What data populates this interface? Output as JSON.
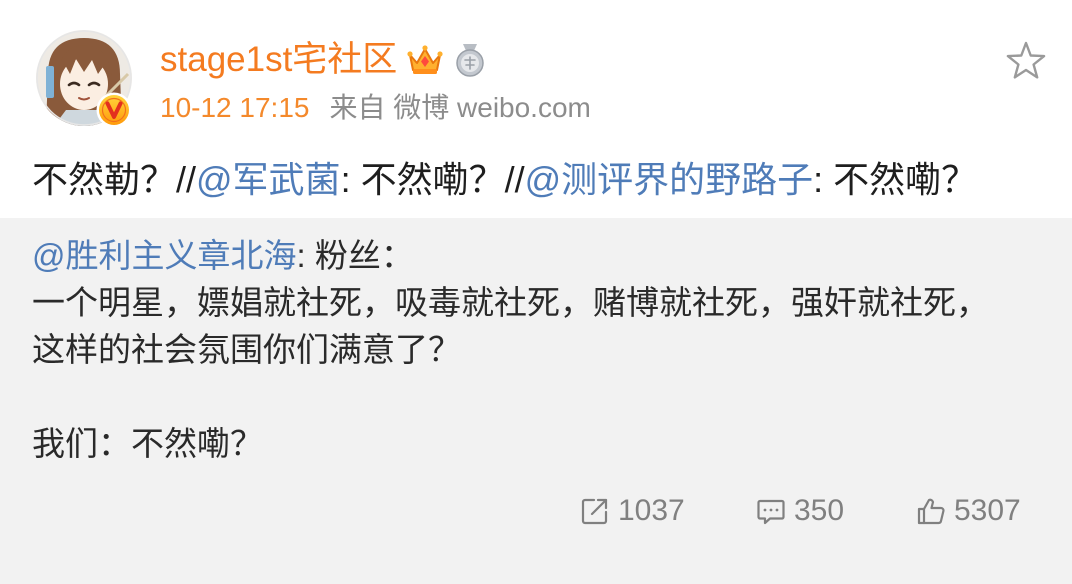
{
  "colors": {
    "name": "#f47b20",
    "time": "#f4892b",
    "muted": "#8c8c8c",
    "link": "#4f7cb8",
    "retweet_bg": "#f2f2f2",
    "action": "#808080"
  },
  "post": {
    "author": {
      "name": "stage1st宅社区",
      "avatar_icon": "avatar-anime-girl",
      "verified_icon": "verified-v-icon",
      "badges": [
        {
          "icon": "crown-icon"
        },
        {
          "icon": "medal-icon"
        }
      ]
    },
    "meta": {
      "time": "10-12 17:15",
      "source": "来自 微博 weibo.com"
    },
    "favorite_icon": "star-outline-icon",
    "text": [
      "不然勒？//",
      "@军武菌",
      ": 不然嘞？//",
      "@测评界的野路子",
      ": 不然嘞？"
    ],
    "retweet": {
      "author_mention": "@胜利主义章北海",
      "head_rest": ": 粉丝：",
      "lines": [
        "一个明星，嫖娼就社死，吸毒就社死，赌博就社死，强奸就社死，",
        "这样的社会氛围你们满意了？",
        "",
        "我们：不然嘞？"
      ]
    },
    "actions": {
      "repost": {
        "icon": "share-icon",
        "count": "1037"
      },
      "comment": {
        "icon": "comment-icon",
        "count": "350"
      },
      "like": {
        "icon": "like-icon",
        "count": "5307"
      }
    }
  }
}
